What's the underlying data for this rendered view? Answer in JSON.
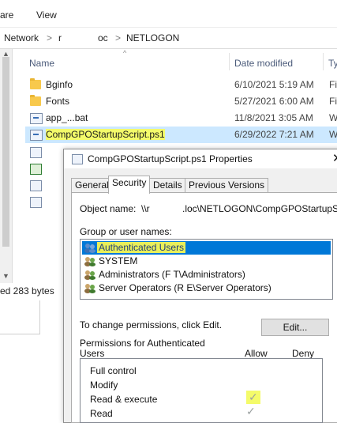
{
  "explorer": {
    "ribbon_tabs": [
      "are",
      "View"
    ],
    "address": {
      "network": "Network",
      "sep": ">",
      "r": "r",
      "oc": "oc",
      "netlogon": "NETLOGON"
    },
    "columns": {
      "name": "Name",
      "date": "Date modified",
      "type": "Ty"
    },
    "files": [
      {
        "name": "Bginfo",
        "date": "6/10/2021 5:19 AM",
        "type": "Fi",
        "icon": "folder-icon"
      },
      {
        "name": "Fonts",
        "date": "5/27/2021 6:00 AM",
        "type": "Fi",
        "icon": "folder-icon"
      },
      {
        "name": "app_...bat",
        "date": "11/8/2021 3:05 AM",
        "type": "W",
        "icon": "script-file-icon"
      },
      {
        "name": "CompGPOStartupScript.ps1",
        "date": "6/29/2022 7:21 AM",
        "type": "W",
        "icon": "script-file-icon"
      }
    ],
    "status": "ed  283 bytes"
  },
  "dialog": {
    "title": "CompGPOStartupScript.ps1 Properties",
    "close": "✕",
    "tabs": [
      "General",
      "Security",
      "Details",
      "Previous Versions"
    ],
    "active_tab": "Security",
    "object_label": "Object name:",
    "object_value_a": "\\\\r",
    "object_value_b": ".loc\\NETLOGON\\CompGPOStartupScri",
    "group_label": "Group or user names:",
    "users": [
      "Authenticated Users",
      "SYSTEM",
      "Administrators (F                    T\\Administrators)",
      "Server Operators (R                  E\\Server Operators)"
    ],
    "change_text": "To change permissions, click Edit.",
    "edit_button": "Edit...",
    "perm_for": "Permissions for Authenticated",
    "perm_for2": "Users",
    "allow": "Allow",
    "deny": "Deny",
    "permissions": [
      "Full control",
      "Modify",
      "Read & execute",
      "Read"
    ],
    "check_mark": "✓"
  },
  "colors": {
    "selection": "#cce8ff",
    "highlight": "#f4fb6a",
    "accent": "#0078d7"
  }
}
